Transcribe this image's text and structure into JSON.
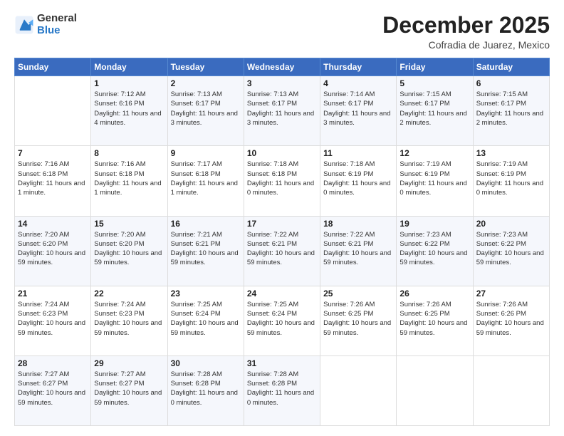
{
  "logo": {
    "general": "General",
    "blue": "Blue"
  },
  "header": {
    "month": "December 2025",
    "location": "Cofradia de Juarez, Mexico"
  },
  "days_of_week": [
    "Sunday",
    "Monday",
    "Tuesday",
    "Wednesday",
    "Thursday",
    "Friday",
    "Saturday"
  ],
  "weeks": [
    [
      {
        "day": "",
        "detail": ""
      },
      {
        "day": "1",
        "detail": "Sunrise: 7:12 AM\nSunset: 6:16 PM\nDaylight: 11 hours\nand 4 minutes."
      },
      {
        "day": "2",
        "detail": "Sunrise: 7:13 AM\nSunset: 6:17 PM\nDaylight: 11 hours\nand 3 minutes."
      },
      {
        "day": "3",
        "detail": "Sunrise: 7:13 AM\nSunset: 6:17 PM\nDaylight: 11 hours\nand 3 minutes."
      },
      {
        "day": "4",
        "detail": "Sunrise: 7:14 AM\nSunset: 6:17 PM\nDaylight: 11 hours\nand 3 minutes."
      },
      {
        "day": "5",
        "detail": "Sunrise: 7:15 AM\nSunset: 6:17 PM\nDaylight: 11 hours\nand 2 minutes."
      },
      {
        "day": "6",
        "detail": "Sunrise: 7:15 AM\nSunset: 6:17 PM\nDaylight: 11 hours\nand 2 minutes."
      }
    ],
    [
      {
        "day": "7",
        "detail": "Sunrise: 7:16 AM\nSunset: 6:18 PM\nDaylight: 11 hours\nand 1 minute."
      },
      {
        "day": "8",
        "detail": "Sunrise: 7:16 AM\nSunset: 6:18 PM\nDaylight: 11 hours\nand 1 minute."
      },
      {
        "day": "9",
        "detail": "Sunrise: 7:17 AM\nSunset: 6:18 PM\nDaylight: 11 hours\nand 1 minute."
      },
      {
        "day": "10",
        "detail": "Sunrise: 7:18 AM\nSunset: 6:18 PM\nDaylight: 11 hours\nand 0 minutes."
      },
      {
        "day": "11",
        "detail": "Sunrise: 7:18 AM\nSunset: 6:19 PM\nDaylight: 11 hours\nand 0 minutes."
      },
      {
        "day": "12",
        "detail": "Sunrise: 7:19 AM\nSunset: 6:19 PM\nDaylight: 11 hours\nand 0 minutes."
      },
      {
        "day": "13",
        "detail": "Sunrise: 7:19 AM\nSunset: 6:19 PM\nDaylight: 11 hours\nand 0 minutes."
      }
    ],
    [
      {
        "day": "14",
        "detail": "Sunrise: 7:20 AM\nSunset: 6:20 PM\nDaylight: 10 hours\nand 59 minutes."
      },
      {
        "day": "15",
        "detail": "Sunrise: 7:20 AM\nSunset: 6:20 PM\nDaylight: 10 hours\nand 59 minutes."
      },
      {
        "day": "16",
        "detail": "Sunrise: 7:21 AM\nSunset: 6:21 PM\nDaylight: 10 hours\nand 59 minutes."
      },
      {
        "day": "17",
        "detail": "Sunrise: 7:22 AM\nSunset: 6:21 PM\nDaylight: 10 hours\nand 59 minutes."
      },
      {
        "day": "18",
        "detail": "Sunrise: 7:22 AM\nSunset: 6:21 PM\nDaylight: 10 hours\nand 59 minutes."
      },
      {
        "day": "19",
        "detail": "Sunrise: 7:23 AM\nSunset: 6:22 PM\nDaylight: 10 hours\nand 59 minutes."
      },
      {
        "day": "20",
        "detail": "Sunrise: 7:23 AM\nSunset: 6:22 PM\nDaylight: 10 hours\nand 59 minutes."
      }
    ],
    [
      {
        "day": "21",
        "detail": "Sunrise: 7:24 AM\nSunset: 6:23 PM\nDaylight: 10 hours\nand 59 minutes."
      },
      {
        "day": "22",
        "detail": "Sunrise: 7:24 AM\nSunset: 6:23 PM\nDaylight: 10 hours\nand 59 minutes."
      },
      {
        "day": "23",
        "detail": "Sunrise: 7:25 AM\nSunset: 6:24 PM\nDaylight: 10 hours\nand 59 minutes."
      },
      {
        "day": "24",
        "detail": "Sunrise: 7:25 AM\nSunset: 6:24 PM\nDaylight: 10 hours\nand 59 minutes."
      },
      {
        "day": "25",
        "detail": "Sunrise: 7:26 AM\nSunset: 6:25 PM\nDaylight: 10 hours\nand 59 minutes."
      },
      {
        "day": "26",
        "detail": "Sunrise: 7:26 AM\nSunset: 6:25 PM\nDaylight: 10 hours\nand 59 minutes."
      },
      {
        "day": "27",
        "detail": "Sunrise: 7:26 AM\nSunset: 6:26 PM\nDaylight: 10 hours\nand 59 minutes."
      }
    ],
    [
      {
        "day": "28",
        "detail": "Sunrise: 7:27 AM\nSunset: 6:27 PM\nDaylight: 10 hours\nand 59 minutes."
      },
      {
        "day": "29",
        "detail": "Sunrise: 7:27 AM\nSunset: 6:27 PM\nDaylight: 10 hours\nand 59 minutes."
      },
      {
        "day": "30",
        "detail": "Sunrise: 7:28 AM\nSunset: 6:28 PM\nDaylight: 11 hours\nand 0 minutes."
      },
      {
        "day": "31",
        "detail": "Sunrise: 7:28 AM\nSunset: 6:28 PM\nDaylight: 11 hours\nand 0 minutes."
      },
      {
        "day": "",
        "detail": ""
      },
      {
        "day": "",
        "detail": ""
      },
      {
        "day": "",
        "detail": ""
      }
    ]
  ]
}
